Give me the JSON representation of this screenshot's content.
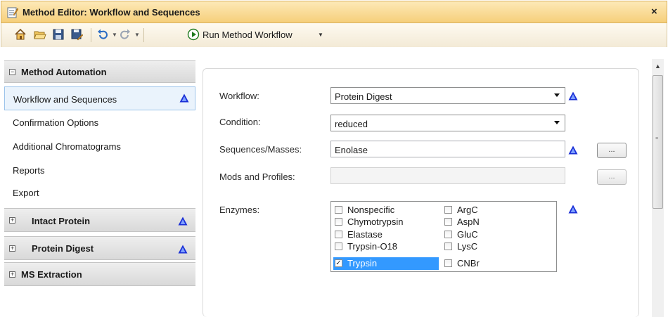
{
  "window": {
    "title": "Method Editor: Workflow and Sequences",
    "close_label": "×"
  },
  "toolbar": {
    "icons": [
      "home-icon",
      "open-icon",
      "save-icon",
      "save-as-icon",
      "undo-icon",
      "redo-icon",
      "run-icon"
    ],
    "run_label": "Run Method Workflow",
    "dropdown_glyph": "▼"
  },
  "sidebar": {
    "groups": [
      {
        "label": "Method Automation",
        "expander": "−",
        "expanded": true
      },
      {
        "label": "Intact Protein",
        "expander": "+",
        "expanded": false
      },
      {
        "label": "Protein Digest",
        "expander": "+",
        "expanded": false
      },
      {
        "label": "MS Extraction",
        "expander": "+",
        "expanded": false
      }
    ],
    "items": [
      {
        "label": "Workflow and Sequences",
        "selected": true
      },
      {
        "label": "Confirmation Options"
      },
      {
        "label": "Additional Chromatograms"
      },
      {
        "label": "Reports"
      },
      {
        "label": "Export"
      }
    ]
  },
  "form": {
    "workflow": {
      "label": "Workflow:",
      "value": "Protein Digest"
    },
    "condition": {
      "label": "Condition:",
      "value": "reduced"
    },
    "sequences": {
      "label": "Sequences/Masses:",
      "value": "Enolase",
      "button": "..."
    },
    "mods": {
      "label": "Mods and Profiles:",
      "value": "",
      "button": "..."
    },
    "enzymes": {
      "label": "Enzymes:",
      "column1": [
        {
          "label": "Nonspecific",
          "checked": false
        },
        {
          "label": "Chymotrypsin",
          "checked": false
        },
        {
          "label": "Elastase",
          "checked": false
        },
        {
          "label": "Trypsin-O18",
          "checked": false
        },
        {
          "label": "Trypsin",
          "checked": true,
          "selected": true
        }
      ],
      "column2": [
        {
          "label": "ArgC",
          "checked": false
        },
        {
          "label": "AspN",
          "checked": false
        },
        {
          "label": "GluC",
          "checked": false
        },
        {
          "label": "LysC",
          "checked": false
        },
        {
          "label": "CNBr",
          "checked": false
        }
      ],
      "check_glyph": "✓"
    }
  },
  "colors": {
    "title_bar": "#f6cf7a",
    "selection": "#3399ff",
    "warning_icon": "#1a2fd6"
  }
}
